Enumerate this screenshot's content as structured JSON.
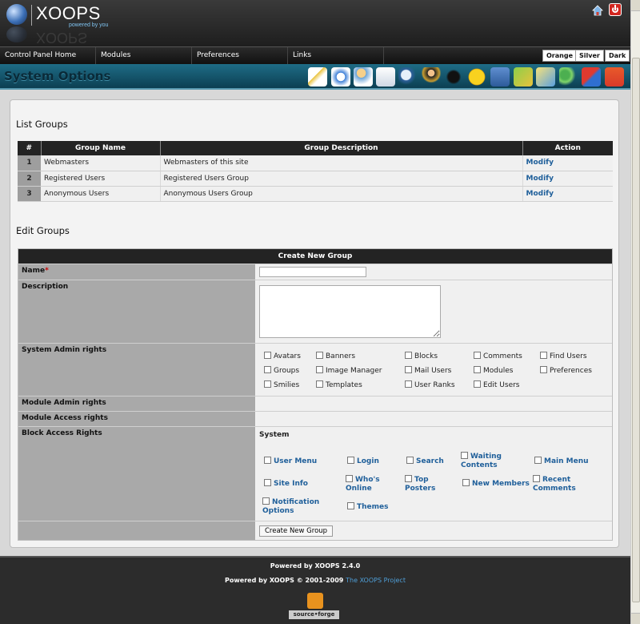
{
  "header": {
    "logo_text": "XOOPS",
    "logo_tagline": "powered by you",
    "logo_reflection": "XOOPS"
  },
  "nav": {
    "items": [
      "Control Panel Home",
      "Modules",
      "Preferences",
      "Links"
    ],
    "themes": [
      "Orange",
      "Silver",
      "Dark"
    ]
  },
  "page_title": "System Options",
  "toolbar_icons": [
    "avatar-icon",
    "banner-icon",
    "block-icon",
    "comment-icon",
    "find-users-icon",
    "group-icon",
    "rank-icon",
    "smiley-icon",
    "image-manager-icon",
    "mail-users-icon",
    "modules-icon",
    "preferences-icon",
    "templates-icon",
    "maintenance-icon"
  ],
  "list_groups": {
    "title": "List Groups",
    "columns": [
      "#",
      "Group Name",
      "Group Description",
      "Action"
    ],
    "rows": [
      {
        "num": "1",
        "name": "Webmasters",
        "description": "Webmasters of this site",
        "action": "Modify"
      },
      {
        "num": "2",
        "name": "Registered Users",
        "description": "Registered Users Group",
        "action": "Modify"
      },
      {
        "num": "3",
        "name": "Anonymous Users",
        "description": "Anonymous Users Group",
        "action": "Modify"
      }
    ]
  },
  "edit_groups": {
    "title": "Edit Groups",
    "form_title": "Create New Group",
    "name_label": "Name",
    "required_mark": "*",
    "name_value": "",
    "description_label": "Description",
    "description_value": "",
    "system_admin_label": "System Admin rights",
    "system_admin_options": [
      "Avatars",
      "Banners",
      "Blocks",
      "Comments",
      "Find Users",
      "Groups",
      "Image Manager",
      "Mail Users",
      "Modules",
      "Preferences",
      "Smilies",
      "Templates",
      "User Ranks",
      "Edit Users"
    ],
    "module_admin_label": "Module Admin rights",
    "module_access_label": "Module Access rights",
    "block_access_label": "Block Access Rights",
    "block_access_module": "System",
    "block_options": [
      "User Menu",
      "Login",
      "Search",
      "Waiting Contents",
      "Main Menu",
      "Site Info",
      "Who's Online",
      "Top Posters",
      "New Members",
      "Recent Comments",
      "Notification Options",
      "Themes"
    ],
    "submit_label": "Create New Group"
  },
  "footer": {
    "powered_line": "Powered by XOOPS 2.4.0",
    "copyright_prefix": "Powered by XOOPS © 2001-2009",
    "project_link": "The XOOPS Project",
    "badge": "source•forge"
  }
}
